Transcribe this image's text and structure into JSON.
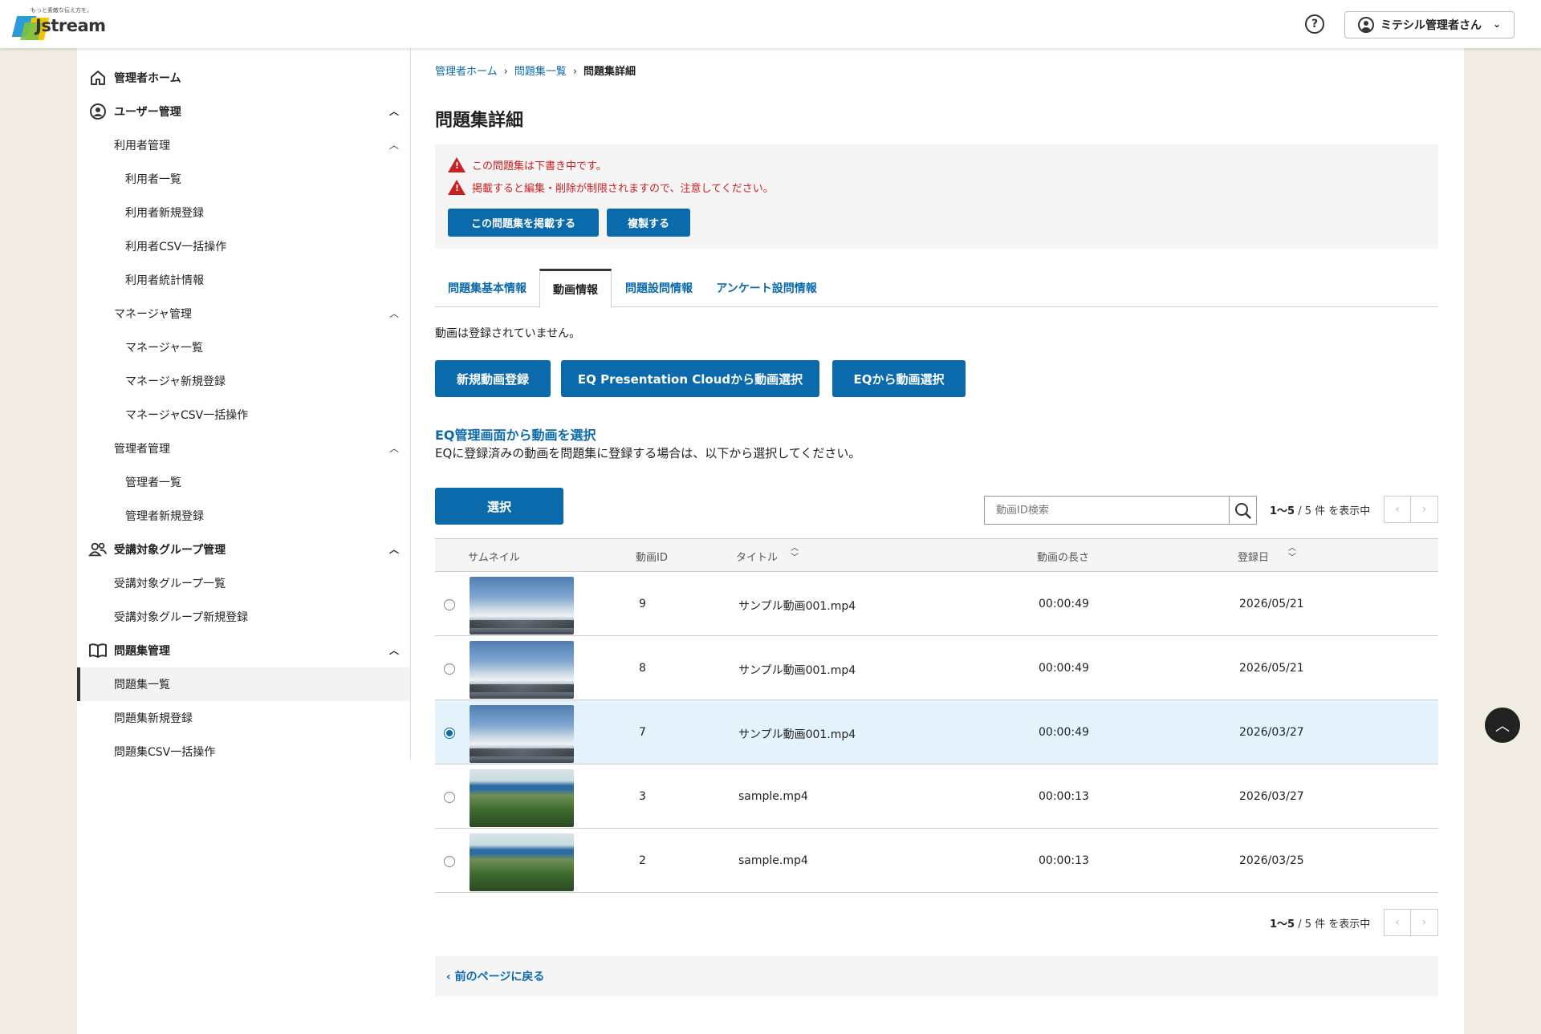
{
  "header": {
    "logo_tagline": "もっと素敵な伝え方を。",
    "logo_text": "Jstream",
    "user_name": "ミテシル管理者さん"
  },
  "sidebar": {
    "home": "管理者ホーム",
    "user_mgmt": "ユーザー管理",
    "user_sub": {
      "title": "利用者管理",
      "items": [
        "利用者一覧",
        "利用者新規登録",
        "利用者CSV一括操作",
        "利用者統計情報"
      ]
    },
    "manager_sub": {
      "title": "マネージャ管理",
      "items": [
        "マネージャ一覧",
        "マネージャ新規登録",
        "マネージャCSV一括操作"
      ]
    },
    "admin_sub": {
      "title": "管理者管理",
      "items": [
        "管理者一覧",
        "管理者新規登録"
      ]
    },
    "group_mgmt": "受講対象グループ管理",
    "group_items": [
      "受講対象グループ一覧",
      "受講対象グループ新規登録"
    ],
    "quiz_mgmt": "問題集管理",
    "quiz_items": [
      "問題集一覧",
      "問題集新規登録",
      "問題集CSV一括操作"
    ]
  },
  "breadcrumb": {
    "items": [
      "管理者ホーム",
      "問題集一覧"
    ],
    "current": "問題集詳細"
  },
  "page_title": "問題集詳細",
  "alert": {
    "line1": "この問題集は下書き中です。",
    "line2": "掲載すると編集・削除が制限されますので、注意してください。",
    "publish_button": "この問題集を掲載する",
    "copy_button": "複製する"
  },
  "tabs": [
    "問題集基本情報",
    "動画情報",
    "問題設問情報",
    "アンケート設問情報"
  ],
  "active_tab": "動画情報",
  "video": {
    "empty_message": "動画は登録されていません。",
    "buttons": [
      "新規動画登録",
      "EQ Presentation Cloudから動画選択",
      "EQから動画選択"
    ],
    "section_title": "EQ管理画面から動画を選択",
    "section_desc": "EQに登録済みの動画を問題集に登録する場合は、以下から選択してください。",
    "select_button": "選択",
    "search_placeholder": "動画ID検索",
    "count_range": "1〜5",
    "count_total": " / 5 件 を表示中"
  },
  "table": {
    "headers": [
      "サムネイル",
      "動画ID",
      "タイトル",
      "動画の長さ",
      "登録日"
    ],
    "rows": [
      {
        "id": "9",
        "title": "サンプル動画001.mp4",
        "duration": "00:00:49",
        "date": "2026/05/21",
        "selected": false,
        "thumb": "sky"
      },
      {
        "id": "8",
        "title": "サンプル動画001.mp4",
        "duration": "00:00:49",
        "date": "2026/05/21",
        "selected": false,
        "thumb": "sky"
      },
      {
        "id": "7",
        "title": "サンプル動画001.mp4",
        "duration": "00:00:49",
        "date": "2026/03/27",
        "selected": true,
        "thumb": "sky"
      },
      {
        "id": "3",
        "title": "sample.mp4",
        "duration": "00:00:13",
        "date": "2026/03/27",
        "selected": false,
        "thumb": "sea"
      },
      {
        "id": "2",
        "title": "sample.mp4",
        "duration": "00:00:13",
        "date": "2026/03/25",
        "selected": false,
        "thumb": "sea"
      }
    ]
  },
  "back_link": "前のページに戻る",
  "colors": {
    "primary": "#0b6aab",
    "alert": "#cc1f1f",
    "selected_row": "#e4f2fb",
    "page_bg": "#f2ede2"
  }
}
